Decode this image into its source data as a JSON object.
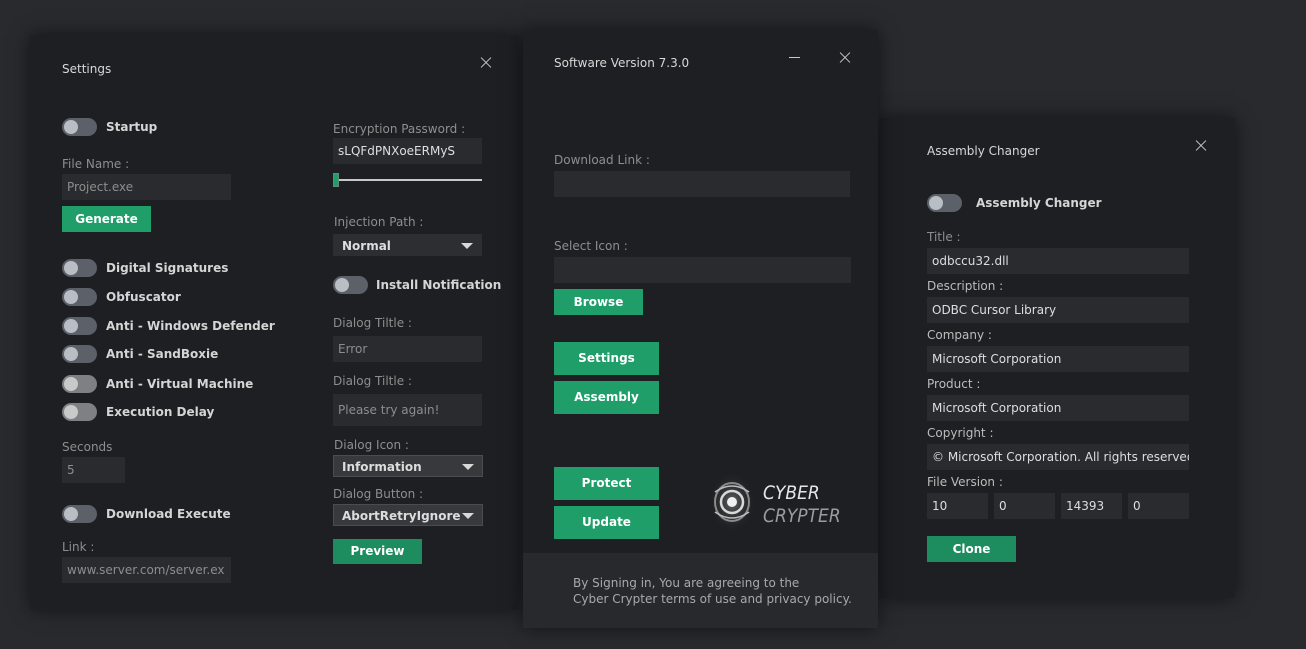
{
  "settings": {
    "title": "Settings",
    "startup_label": "Startup",
    "file_name_label": "File Name :",
    "file_name_value": "Project.exe",
    "generate_label": "Generate",
    "options": [
      {
        "label": "Digital Signatures"
      },
      {
        "label": "Obfuscator"
      },
      {
        "label": "Anti - Windows Defender"
      },
      {
        "label": "Anti - SandBoxie"
      },
      {
        "label": "Anti - Virtual Machine"
      },
      {
        "label": "Execution Delay"
      }
    ],
    "seconds_label": "Seconds",
    "seconds_value": "5",
    "download_execute_label": "Download Execute",
    "link_label": "Link :",
    "link_value": "www.server.com/server.ex",
    "encryption_password_label": "Encryption Password :",
    "encryption_password_value": "sLQFdPNXoeERMyS",
    "password_slider_value": 0,
    "injection_path_label": "Injection Path :",
    "injection_path_value": "Normal",
    "install_notification_label": "Install Notification",
    "dialog_title_label": "Dialog Tiltle :",
    "dialog_title_value": "Error",
    "dialog_text_label": "Dialog Tiltle :",
    "dialog_text_value": "Please try again!",
    "dialog_icon_label": "Dialog Icon :",
    "dialog_icon_value": "Information",
    "dialog_button_label": "Dialog Button :",
    "dialog_button_value": "AbortRetryIgnore",
    "preview_label": "Preview"
  },
  "main": {
    "title": "Software Version 7.3.0",
    "download_link_label": "Download Link :",
    "download_link_value": "",
    "select_icon_label": "Select Icon :",
    "select_icon_value": "",
    "browse_label": "Browse",
    "settings_label": "Settings",
    "assembly_label": "Assembly",
    "protect_label": "Protect",
    "update_label": "Update",
    "logo_word1": "CYBER",
    "logo_word2": "CRYPTER",
    "footer_line1": "By Signing in, You are agreeing to the",
    "footer_line2": "Cyber Crypter terms of use and privacy policy."
  },
  "assembly": {
    "title": "Assembly Changer",
    "toggle_label": "Assembly Changer",
    "title_label": "Title :",
    "title_value": "odbccu32.dll",
    "description_label": "Description :",
    "description_value": "ODBC Cursor Library",
    "company_label": "Company :",
    "company_value": "Microsoft Corporation",
    "product_label": "Product :",
    "product_value": "Microsoft Corporation",
    "copyright_label": "Copyright :",
    "copyright_value": "© Microsoft Corporation. All rights reserved.",
    "file_version_label": "File Version :",
    "file_version_values": [
      "10",
      "0",
      "14393",
      "0"
    ],
    "clone_label": "Clone"
  },
  "colors": {
    "accent": "#1f9e6a",
    "window_bg": "#1e1f22",
    "input_bg": "#2a2b2f",
    "page_bg": "#292a2e"
  }
}
